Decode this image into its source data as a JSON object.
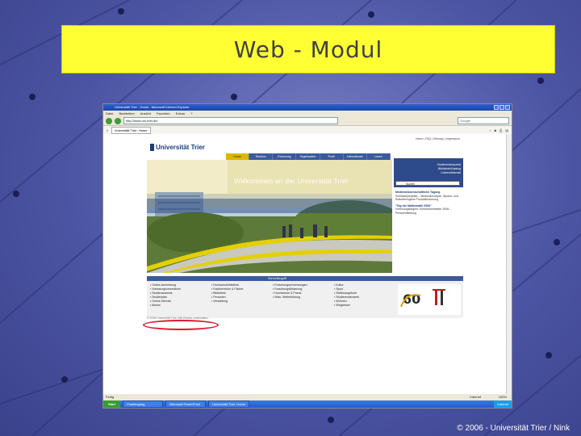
{
  "slide": {
    "title": "Web - Modul",
    "footer": "© 2006 - Universität Trier / Nink"
  },
  "browser": {
    "window_title": "Universität Trier - Home - Microsoft Internet Explorer",
    "menu": [
      "Datei",
      "Bearbeiten",
      "Ansicht",
      "Favoriten",
      "Extras",
      "?"
    ],
    "url": "http://www.uni-trier.de/",
    "search_placeholder": "Google",
    "tab_label": "Universität Trier: Home",
    "status_text": "Fertig",
    "zone_text": "Internet",
    "zoom_text": "100%"
  },
  "taskbar": {
    "start_label": "Start",
    "items": [
      "Posteingang",
      "Microsoft PowerPoint",
      "Universität Trier: Home"
    ],
    "clock": "Internet"
  },
  "page": {
    "top_links": "Home | FAQ | Sitemap | Impressum",
    "logo_text": "Universität Trier",
    "nav": [
      "Home",
      "Studium",
      "Forschung",
      "Organisation",
      "Profil",
      "International",
      "Lesen"
    ],
    "welcome": "Willkommen an der Universität Trier",
    "side_box": [
      "Studierendenportal",
      "Bibliothek/Katalog",
      "Universitätsmail"
    ],
    "search_value": "Suche!",
    "news": [
      {
        "heading": "Medienwissenschaftliche Tagung",
        "text": "Schlüsselprojekte – Medienkonzepte, Sprach- und Kulturbezogene Produktforschung"
      },
      {
        "heading": "\"Tag der Mathematik 2006\"",
        "text": "Vorlesungsbeginn: Sommersemester 2006 – Pressemitteilung"
      }
    ],
    "quick_title": "Schnellzugriff",
    "quick_columns": [
      [
        "• Online-Anmeldung",
        "• Vorlesungsverzeichnis",
        "• Studienausweis",
        "• Studienplan",
        "• Online-Dienste",
        "• Alumni"
      ],
      [
        "• Hochschulbibliothek",
        "• Fachbereiche & Fächer",
        "• Bibliothek",
        "• Personen",
        "• Verwaltung"
      ],
      [
        "• Forschungseinrichtungen",
        "• Forschungsförderung",
        "• Hochschule & Praxis",
        "• Wiss. Weiterbildung"
      ],
      [
        "• Kultur",
        "• Sport",
        "• Stellenangebote",
        "• Studierendenwerk",
        "• Wohnen",
        "• Wegweiser"
      ]
    ],
    "copyright": "© 2006 Universität Trier. Alle Rechte vorbehalten."
  }
}
